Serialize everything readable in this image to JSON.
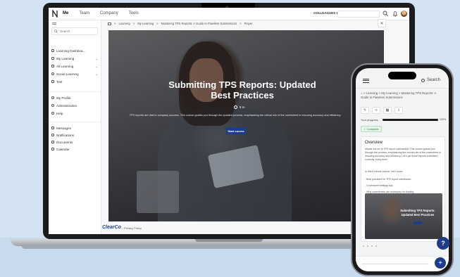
{
  "topbar": {
    "nav": [
      "Me",
      "Team",
      "Company",
      "Tools"
    ],
    "selector": "COLLEAGUES ▾"
  },
  "sidebar": {
    "search_placeholder": "Search",
    "items": [
      {
        "label": "Learning Dashboa...",
        "chevron": ""
      },
      {
        "label": "My Learning",
        "chevron": "⌄"
      },
      {
        "label": "All Learning",
        "chevron": "⌄"
      },
      {
        "label": "Social Learning",
        "chevron": "⌄"
      },
      {
        "label": "Test",
        "chevron": ""
      }
    ],
    "items2": [
      {
        "label": "My Profile"
      },
      {
        "label": "Administration"
      },
      {
        "label": "Help"
      }
    ],
    "items3": [
      {
        "label": "Messages"
      },
      {
        "label": "Notifications"
      },
      {
        "label": "Documents"
      },
      {
        "label": "Calendar"
      }
    ]
  },
  "breadcrumb": [
    "Learning",
    "My Learning",
    "Mastering TPS Reports: A Guide to Flawless Submissions",
    "Player"
  ],
  "breadcrumb_sep": ">",
  "hero": {
    "title": "Submitting TPS Reports: Updated Best Practices",
    "duration": "5 m",
    "description": "TPS reports are vital to company success. This course guides you through the updated process, emphasizing the critical role of the coversheet in ensuring accuracy and efficiency.",
    "start_label": "Start course"
  },
  "close_label": "✕",
  "footer": {
    "logo": "ClearCo",
    "policy": "Privacy Policy"
  },
  "phone": {
    "search_label": "Search",
    "breadcrumb": "⌂ > Learning > My Learning > Mastering TPS Reports: A Guide to Flawless Submissions",
    "progress_label": "Your progress",
    "progress_value": "100%",
    "progress_fraction": 1.0,
    "complete_label": "✓ Complete",
    "overview_title": "Overview",
    "overview_text": "Master the art of TPS report submission! This course guides you through the process, emphasizing the crucial role of the coversheet in ensuring accuracy and efficiency. Let's get those reports submitted correctly, every time!",
    "overview_intro": "In this 5 minute course, we'll cover:",
    "bullets": [
      "- Best practices for TPS report submission",
      "- Coversheet settings tips",
      "- Why coversheets are necessary for binding"
    ],
    "thumb_title": "Submitting TPS Reports: Updated Best Practices",
    "help_label": "?",
    "fab_label": "+"
  }
}
